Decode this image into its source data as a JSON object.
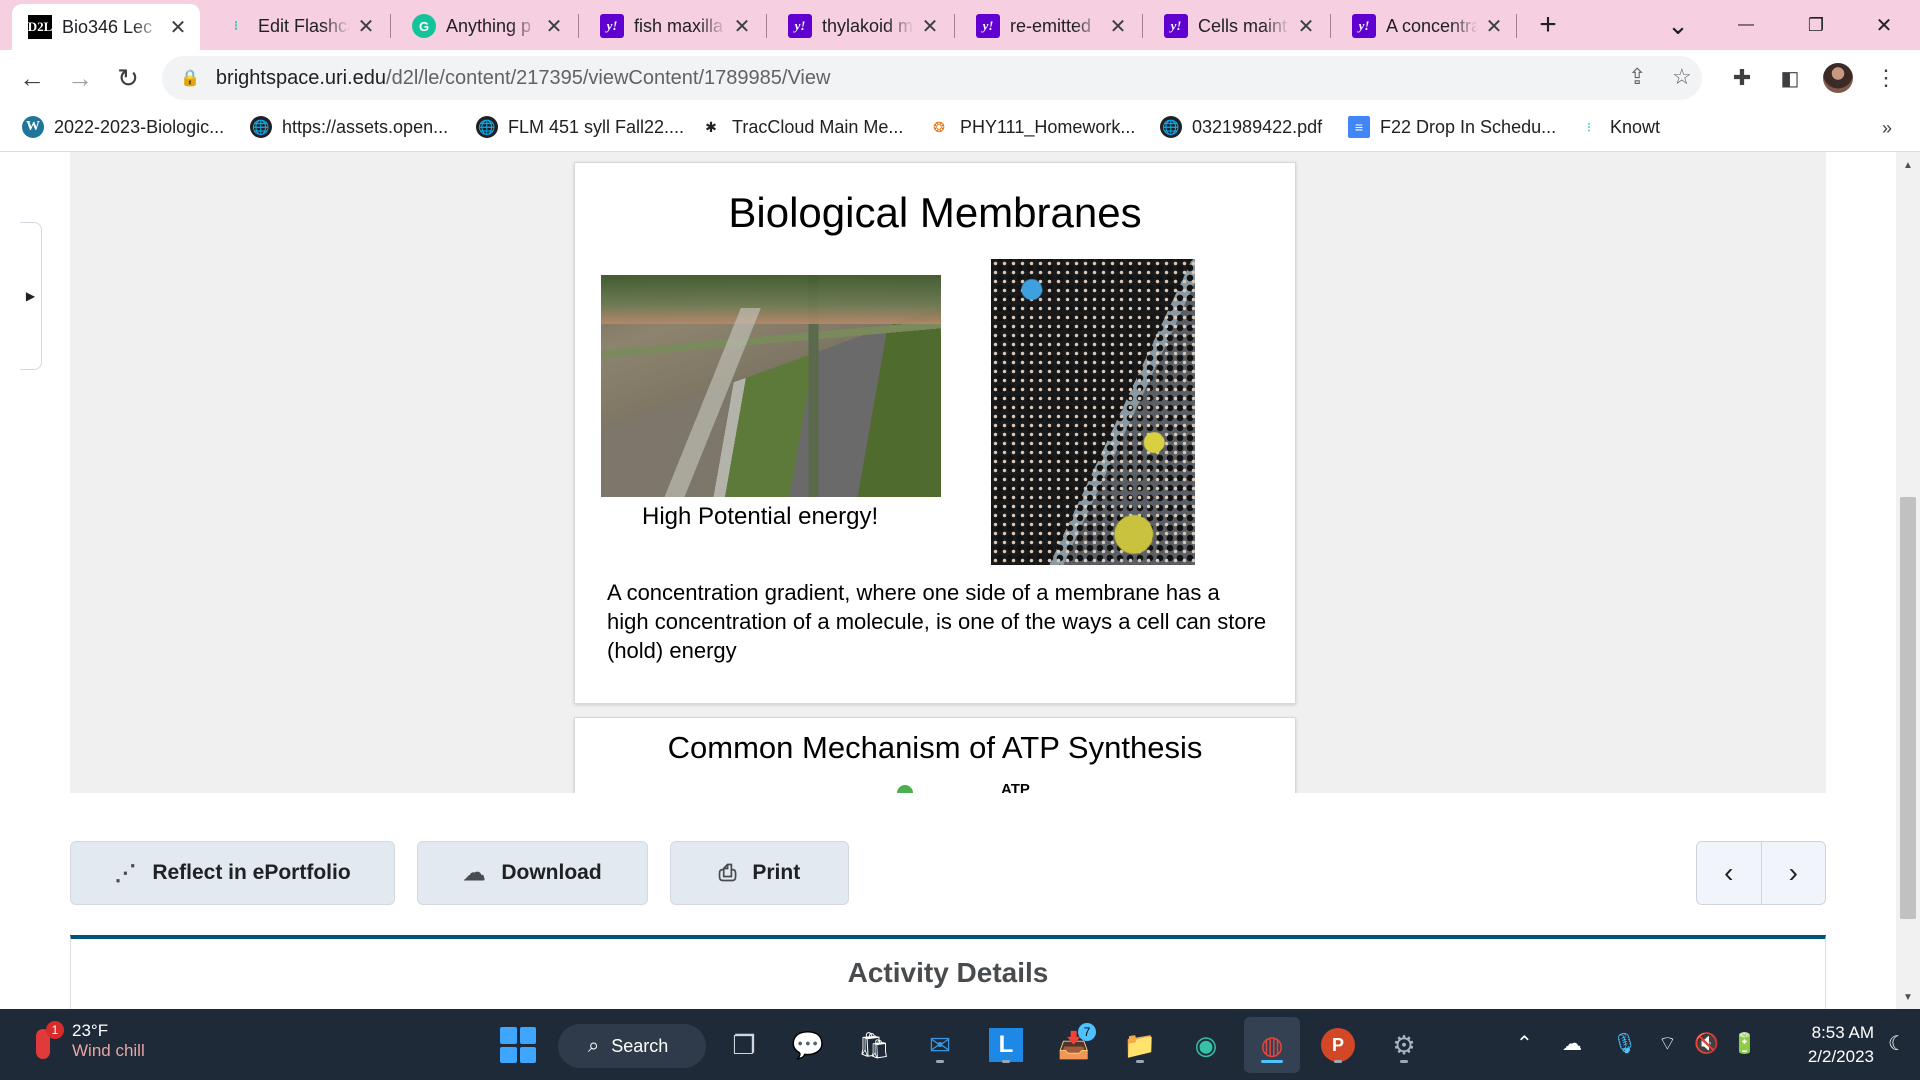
{
  "browser": {
    "tabs": [
      {
        "title": "Bio346 Lec",
        "icon": "d2l-icon",
        "favicon_text": "D2L",
        "active": true
      },
      {
        "title": "Edit Flashca",
        "icon": "knowt-icon",
        "favicon_text": "⁝"
      },
      {
        "title": "Anything p",
        "icon": "grammarly-icon",
        "favicon_text": "G"
      },
      {
        "title": "fish maxilla",
        "icon": "yahoo-icon",
        "favicon_text": "y!"
      },
      {
        "title": "thylakoid m",
        "icon": "yahoo-icon",
        "favicon_text": "y!"
      },
      {
        "title": "re-emitted",
        "icon": "yahoo-icon",
        "favicon_text": "y!"
      },
      {
        "title": "Cells maint",
        "icon": "yahoo-icon",
        "favicon_text": "y!"
      },
      {
        "title": "A concentra",
        "icon": "yahoo-icon",
        "favicon_text": "y!"
      }
    ],
    "close_glyph": "✕",
    "new_tab_glyph": "+",
    "tab_search_glyph": "⌄",
    "minimize_glyph": "—",
    "restore_glyph": "❐",
    "close_window_glyph": "✕",
    "url_host": "brightspace.uri.edu",
    "url_path": "/d2l/le/content/217395/viewContent/1789985/View",
    "bookmarks": [
      {
        "label": "2022-2023-Biologic...",
        "icon": "wordpress-icon",
        "glyph": "W"
      },
      {
        "label": "https://assets.open...",
        "icon": "globe-icon",
        "glyph": "🌐"
      },
      {
        "label": "FLM 451 syll Fall22....",
        "icon": "globe-icon",
        "glyph": "🌐"
      },
      {
        "label": "TracCloud Main Me...",
        "icon": "traccloud-icon",
        "glyph": "✱"
      },
      {
        "label": "PHY111_Homework...",
        "icon": "phy-icon",
        "glyph": "❂"
      },
      {
        "label": "0321989422.pdf",
        "icon": "globe-icon",
        "glyph": "🌐"
      },
      {
        "label": "F22 Drop In Schedu...",
        "icon": "docs-icon",
        "glyph": "≡"
      },
      {
        "label": "Knowt",
        "icon": "knowt-icon",
        "glyph": "⁝"
      }
    ],
    "bookmarks_more": "»"
  },
  "viewer": {
    "slide1": {
      "title": "Biological Membranes",
      "caption": "High Potential energy!",
      "body": "A concentration gradient, where one side of a membrane has a high concentration of a molecule, is one of the ways a cell can store (hold) energy"
    },
    "slide2": {
      "title": "Common Mechanism of ATP Synthesis",
      "label": "ATP"
    }
  },
  "actions": {
    "reflect": "Reflect in ePortfolio",
    "download": "Download",
    "print": "Print",
    "prev": "‹",
    "next": "›"
  },
  "activity_details": {
    "heading": "Activity Details"
  },
  "taskbar": {
    "weather_temp": "23°F",
    "weather_cond": "Wind chill",
    "weather_badge": "1",
    "search_label": "Search",
    "outlook_badge": "7",
    "time": "8:53 AM",
    "date": "2/2/2023"
  }
}
